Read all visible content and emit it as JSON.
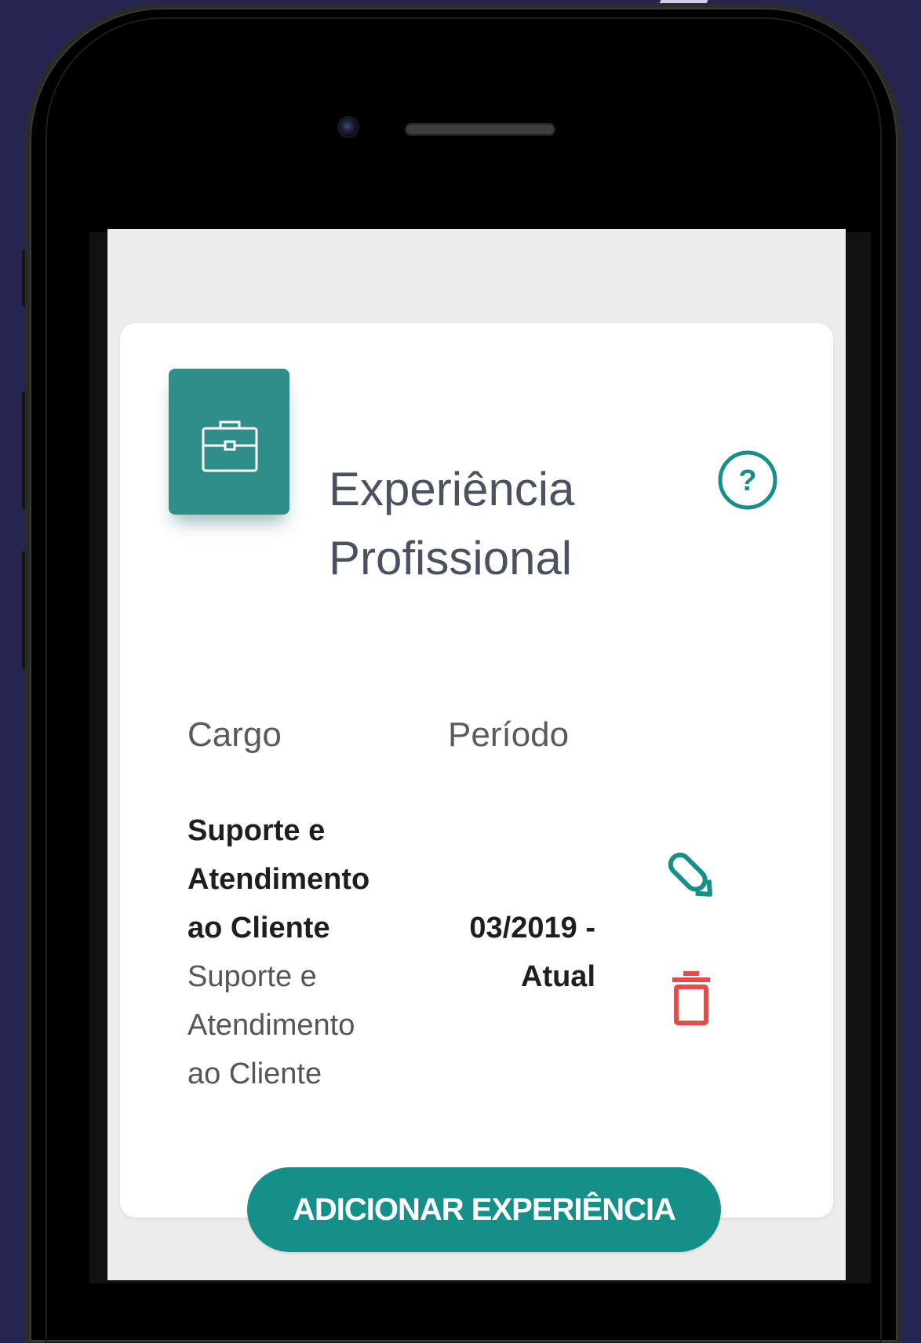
{
  "card": {
    "title": "Experiência Profissional",
    "columns": {
      "cargo": "Cargo",
      "periodo": "Período"
    },
    "entries": [
      {
        "title": "Suporte e Atendimento ao Cliente",
        "company": "Suporte e Atendimento ao Cliente",
        "period": "03/2019 - Atual"
      }
    ],
    "add_button": "ADICIONAR EXPERIÊNCIA"
  },
  "colors": {
    "background": "#262450",
    "accent": "#159088",
    "icon_box": "#2f8d8a",
    "delete": "#e84a4a"
  },
  "icons": {
    "card_icon": "briefcase-icon",
    "help": "help-circle-icon",
    "edit": "pencil-icon",
    "delete": "trash-icon"
  }
}
